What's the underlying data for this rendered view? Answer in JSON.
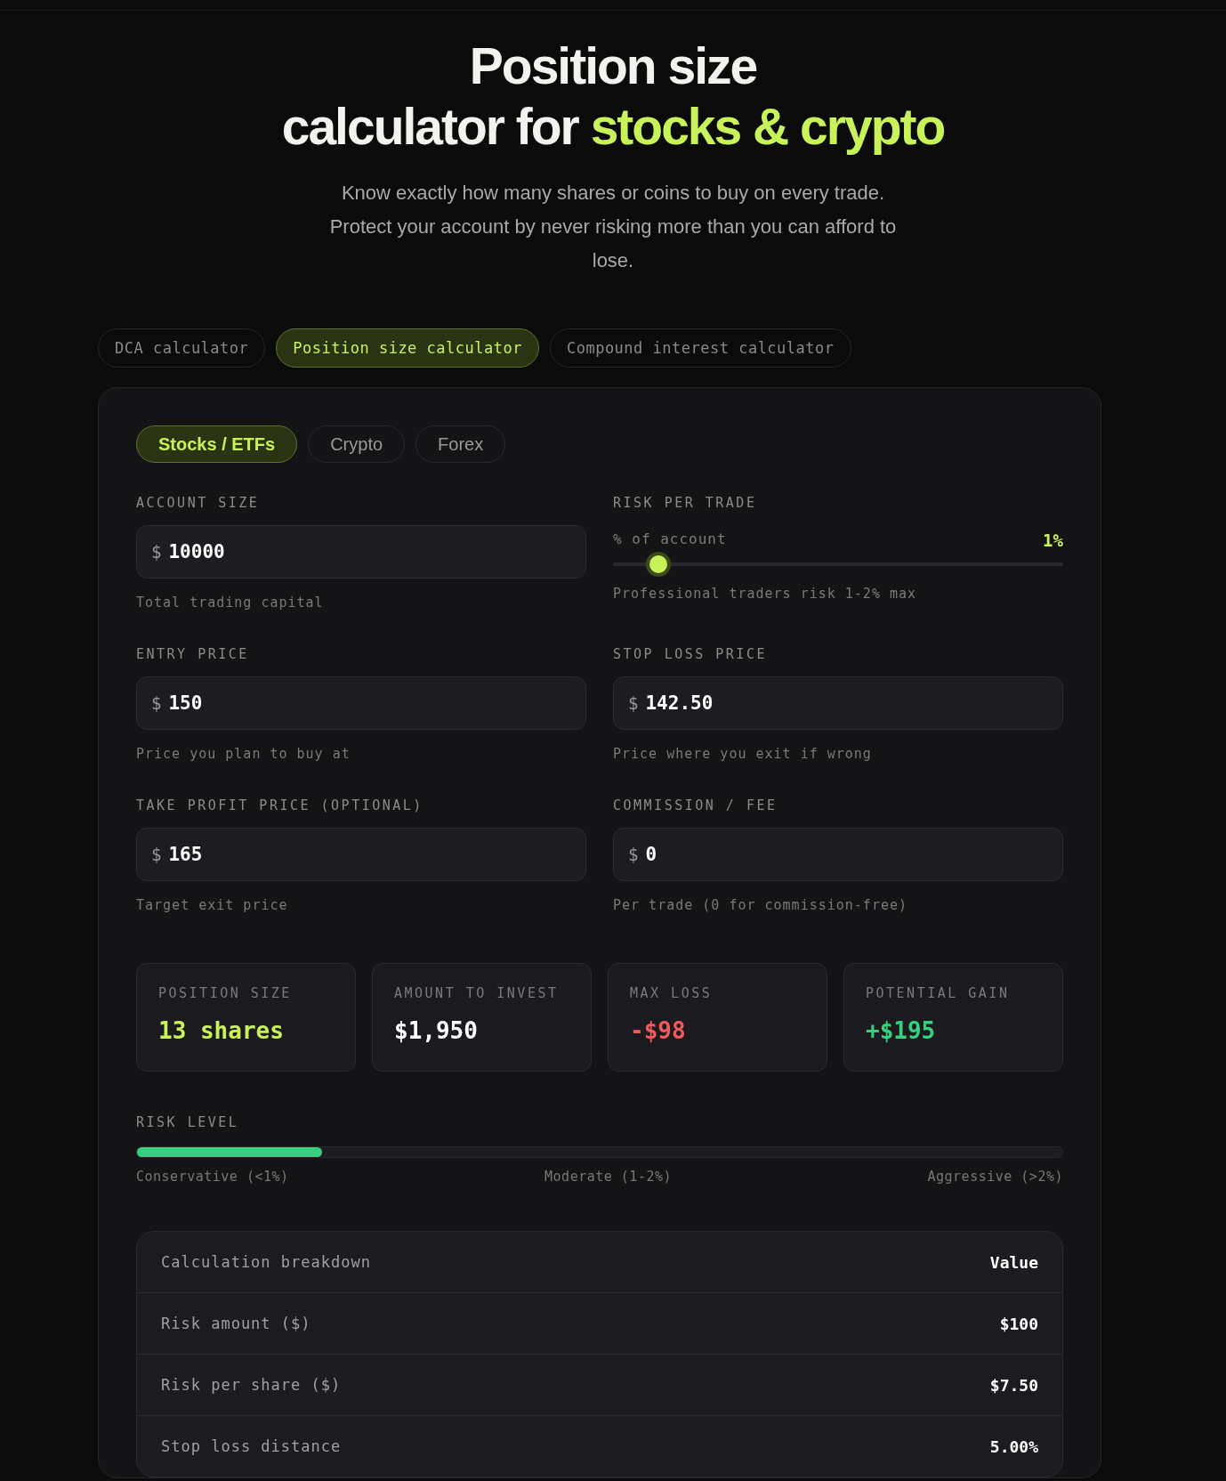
{
  "hero": {
    "title_line1": "Position size",
    "title_line2": "calculator for",
    "title_highlight": "stocks & crypto",
    "subtitle": "Know exactly how many shares or coins to buy on every trade. Protect your account by never risking more than you can afford to lose."
  },
  "calculator_tabs": [
    {
      "label": "DCA calculator",
      "selected": false
    },
    {
      "label": "Position size calculator",
      "selected": true
    },
    {
      "label": "Compound interest calculator",
      "selected": false
    }
  ],
  "asset_tabs": [
    {
      "label": "Stocks / ETFs",
      "selected": true
    },
    {
      "label": "Crypto",
      "selected": false
    },
    {
      "label": "Forex",
      "selected": false
    }
  ],
  "fields": [
    {
      "kind": "input",
      "label": "ACCOUNT SIZE",
      "prefix": "$",
      "value": "10000",
      "hint": "Total trading capital"
    },
    {
      "kind": "slider",
      "label": "RISK PER TRADE",
      "sublabel": "% of account",
      "reading": "1%",
      "level": 0.1,
      "hint": "Professional traders risk 1-2% max"
    },
    {
      "kind": "input",
      "label": "ENTRY PRICE",
      "prefix": "$",
      "value": "150",
      "hint": "Price you plan to buy at"
    },
    {
      "kind": "input",
      "label": "STOP LOSS PRICE",
      "prefix": "$",
      "value": "142.50",
      "hint": "Price where you exit if wrong"
    },
    {
      "kind": "input",
      "label": "TAKE PROFIT PRICE (OPTIONAL)",
      "prefix": "$",
      "value": "165",
      "hint": "Target exit price"
    },
    {
      "kind": "input",
      "label": "COMMISSION / FEE",
      "prefix": "$",
      "value": "0",
      "hint": "Per trade (0 for commission-free)"
    }
  ],
  "results": [
    {
      "label": "POSITION SIZE",
      "value": "13 shares",
      "color": "#c8f25a"
    },
    {
      "label": "AMOUNT TO INVEST",
      "value": "$1,950",
      "color": "#ffffff"
    },
    {
      "label": "MAX LOSS",
      "value": "-$98",
      "color": "#f05a5a"
    },
    {
      "label": "POTENTIAL GAIN",
      "value": "+$195",
      "color": "#36d17f"
    }
  ],
  "risk_level": {
    "label": "RISK LEVEL",
    "level": 0.2,
    "scale": [
      "Conservative (<1%)",
      "Moderate (1-2%)",
      "Aggressive (>2%)"
    ]
  },
  "breakdown": {
    "columns": [
      "Calculation breakdown",
      "Value"
    ],
    "rows": [
      {
        "label": "Risk amount ($)",
        "value": "$100"
      },
      {
        "label": "Risk per share ($)",
        "value": "$7.50"
      },
      {
        "label": "Stop loss distance",
        "value": "5.00%"
      }
    ]
  }
}
